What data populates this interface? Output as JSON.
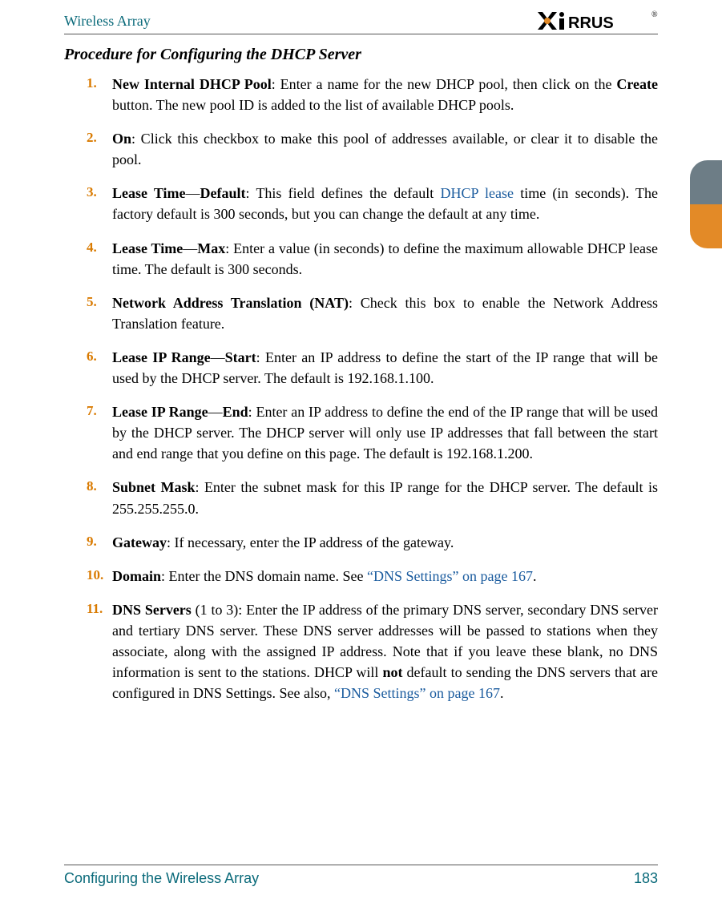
{
  "header": {
    "title": "Wireless Array",
    "logo_text": "XIRRUS"
  },
  "section_title": "Procedure for Configuring the DHCP Server",
  "items": [
    {
      "num": "1.",
      "lead_bold": "New Internal DHCP Pool",
      "sep1": ": Enter a name for the new DHCP pool, then click on the ",
      "bold2": "Create",
      "tail": " button. The new pool ID is added to the list of available DHCP pools."
    },
    {
      "num": "2.",
      "lead_bold": "On",
      "sep1": ": Click this checkbox to make this pool of addresses available, or clear it to disable the pool.",
      "bold2": "",
      "tail": ""
    },
    {
      "num": "3.",
      "lead_bold": "Lease Time",
      "dash": "—",
      "bold2": "Default",
      "sep1": ": This field defines the default ",
      "link1": "DHCP lease",
      "tail": " time (in seconds). The factory default is 300 seconds, but you can change the default at any time."
    },
    {
      "num": "4.",
      "lead_bold": "Lease Time",
      "dash": "—",
      "bold2": "Max",
      "sep1": ": Enter a value (in seconds) to define the maximum allowable DHCP lease time. The default is 300 seconds.",
      "tail": ""
    },
    {
      "num": "5.",
      "lead_bold": "Network Address Translation (NAT)",
      "sep1": ": Check this box to enable the Network Address Translation feature.",
      "bold2": "",
      "tail": ""
    },
    {
      "num": "6.",
      "lead_bold": "Lease IP Range",
      "dash": "—",
      "bold2": "Start",
      "sep1": ": Enter an IP address to define the start of the IP range that will be used by the DHCP server. The default is 192.168.1.100.",
      "tail": ""
    },
    {
      "num": "7.",
      "lead_bold": "Lease IP Range",
      "dash": "—",
      "bold2": "End",
      "sep1": ": Enter an IP address to define the end of the IP range that will be used by the DHCP server. The DHCP server will only use IP addresses that fall between the start and end range that you define on this page. The default is 192.168.1.200.",
      "tail": ""
    },
    {
      "num": "8.",
      "lead_bold": "Subnet Mask",
      "sep1": ": Enter the subnet mask for this IP range for the DHCP server. The default is 255.255.255.0.",
      "bold2": "",
      "tail": ""
    },
    {
      "num": "9.",
      "lead_bold": "Gateway",
      "sep1": ": If necessary, enter the IP address of the gateway.",
      "bold2": "",
      "tail": ""
    },
    {
      "num": "10.",
      "lead_bold": "Domain",
      "sep1": ": Enter the DNS domain name. See ",
      "link1": "“DNS Settings” on page 167",
      "tail": ".",
      "bold2": ""
    },
    {
      "num": "11.",
      "lead_bold": "DNS Servers",
      "sep1": " (1 to 3): Enter the IP address of the primary DNS server, secondary DNS server and tertiary DNS server. These DNS server addresses will be passed to stations when they associate, along with the assigned IP address. Note that if you leave these blank, no DNS information is sent to the stations. DHCP will ",
      "bold2": "not",
      "tail": " default to sending the DNS servers that are configured in DNS Settings. See also, ",
      "link1": "“DNS Settings” on page 167",
      "tail2": "."
    }
  ],
  "footer": {
    "left": "Configuring the Wireless Array",
    "right": "183"
  }
}
